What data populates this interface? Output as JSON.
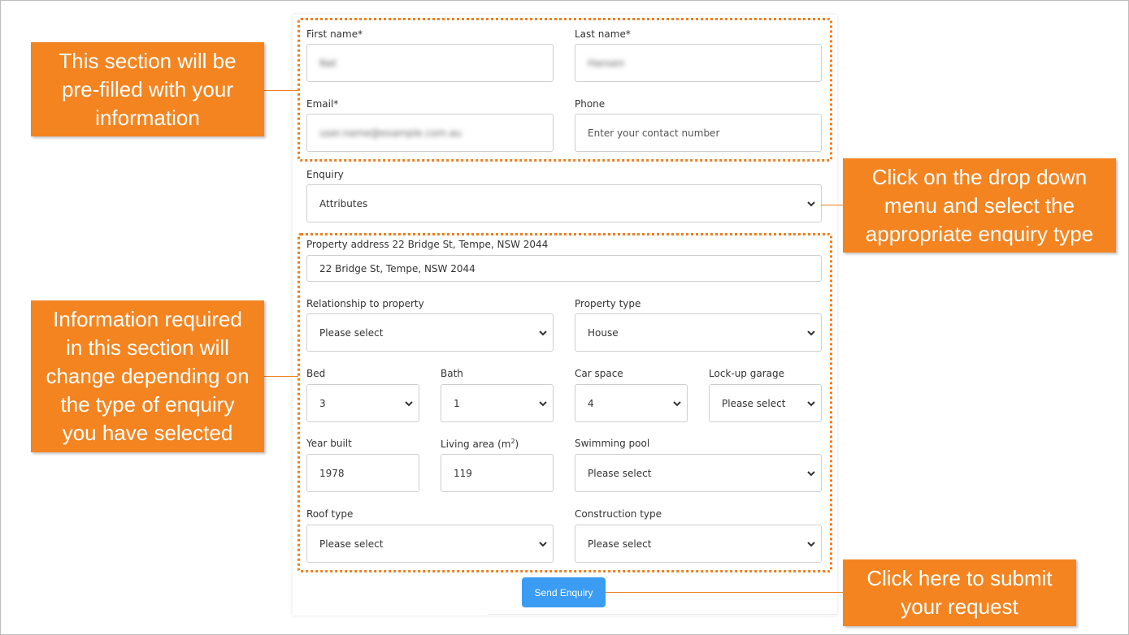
{
  "contact": {
    "first_name_label": "First name*",
    "first_name_value": "Nat",
    "last_name_label": "Last name*",
    "last_name_value": "Hansen",
    "email_label": "Email*",
    "email_value": "user.name@example.com.au",
    "phone_label": "Phone",
    "phone_placeholder": "Enter your contact number"
  },
  "enquiry": {
    "label": "Enquiry",
    "selected": "Attributes"
  },
  "property": {
    "address_label": "Property address 22 Bridge St, Tempe, NSW 2044",
    "address_value": "22 Bridge St, Tempe, NSW 2044",
    "relationship_label": "Relationship to property",
    "relationship_value": "Please select",
    "type_label": "Property type",
    "type_value": "House",
    "bed_label": "Bed",
    "bed_value": "3",
    "bath_label": "Bath",
    "bath_value": "1",
    "car_label": "Car space",
    "car_value": "4",
    "garage_label": "Lock-up garage",
    "garage_value": "Please select",
    "year_label": "Year built",
    "year_value": "1978",
    "living_label": "Living area (m",
    "living_sup": "2",
    "living_close": ")",
    "living_value": "119",
    "pool_label": "Swimming pool",
    "pool_value": "Please select",
    "roof_label": "Roof type",
    "roof_value": "Please select",
    "construction_label": "Construction type",
    "construction_value": "Please select"
  },
  "send_button": "Send Enquiry",
  "callouts": {
    "prefilled": "This section will be\npre-filled with your\ninformation",
    "dropdown": "Click on the drop down\nmenu and select the\nappropriate enquiry type",
    "required": "Information required\nin this section will\nchange depending on\nthe type of enquiry\nyou have selected",
    "submit": "Click here to submit\nyour request"
  },
  "colors": {
    "callout": "#f48420",
    "dotted_border": "#f07e1e",
    "button": "#3b9cf3"
  }
}
